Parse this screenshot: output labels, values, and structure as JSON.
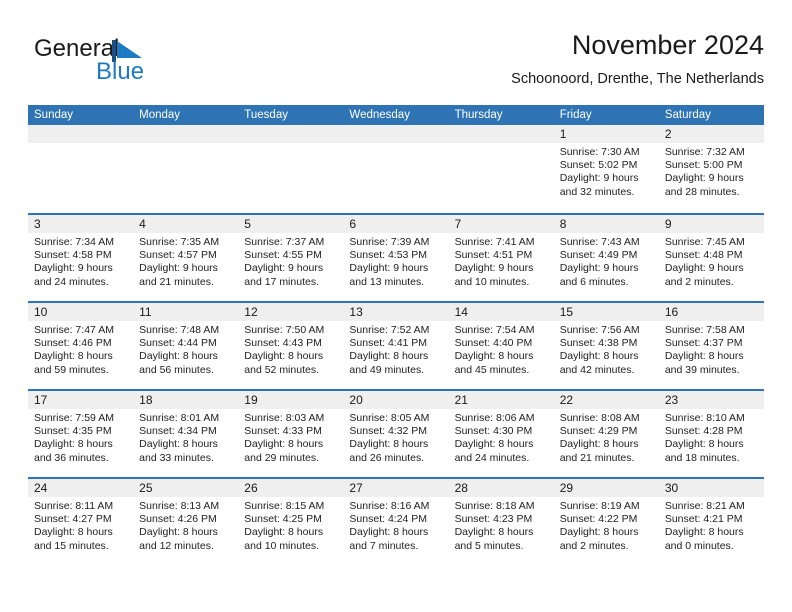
{
  "brand": {
    "word_one": "General",
    "word_two": "Blue",
    "mark": "triangle-flag-icon",
    "accent_color": "#1f7ac4"
  },
  "header": {
    "title": "November 2024",
    "subtitle": "Schoonoord, Drenthe, The Netherlands"
  },
  "colors": {
    "header_blue": "#2e74b5",
    "daynum_band": "#efefef",
    "text": "#1a1a1a"
  },
  "weekdays": [
    "Sunday",
    "Monday",
    "Tuesday",
    "Wednesday",
    "Thursday",
    "Friday",
    "Saturday"
  ],
  "labels": {
    "sunrise": "Sunrise:",
    "sunset": "Sunset:",
    "daylight": "Daylight:"
  },
  "weeks": [
    [
      {
        "day": "",
        "empty": true
      },
      {
        "day": "",
        "empty": true
      },
      {
        "day": "",
        "empty": true
      },
      {
        "day": "",
        "empty": true
      },
      {
        "day": "",
        "empty": true
      },
      {
        "day": "1",
        "sunrise": "Sunrise: 7:30 AM",
        "sunset": "Sunset: 5:02 PM",
        "daylight1": "Daylight: 9 hours",
        "daylight2": "and 32 minutes."
      },
      {
        "day": "2",
        "sunrise": "Sunrise: 7:32 AM",
        "sunset": "Sunset: 5:00 PM",
        "daylight1": "Daylight: 9 hours",
        "daylight2": "and 28 minutes."
      }
    ],
    [
      {
        "day": "3",
        "sunrise": "Sunrise: 7:34 AM",
        "sunset": "Sunset: 4:58 PM",
        "daylight1": "Daylight: 9 hours",
        "daylight2": "and 24 minutes."
      },
      {
        "day": "4",
        "sunrise": "Sunrise: 7:35 AM",
        "sunset": "Sunset: 4:57 PM",
        "daylight1": "Daylight: 9 hours",
        "daylight2": "and 21 minutes."
      },
      {
        "day": "5",
        "sunrise": "Sunrise: 7:37 AM",
        "sunset": "Sunset: 4:55 PM",
        "daylight1": "Daylight: 9 hours",
        "daylight2": "and 17 minutes."
      },
      {
        "day": "6",
        "sunrise": "Sunrise: 7:39 AM",
        "sunset": "Sunset: 4:53 PM",
        "daylight1": "Daylight: 9 hours",
        "daylight2": "and 13 minutes."
      },
      {
        "day": "7",
        "sunrise": "Sunrise: 7:41 AM",
        "sunset": "Sunset: 4:51 PM",
        "daylight1": "Daylight: 9 hours",
        "daylight2": "and 10 minutes."
      },
      {
        "day": "8",
        "sunrise": "Sunrise: 7:43 AM",
        "sunset": "Sunset: 4:49 PM",
        "daylight1": "Daylight: 9 hours",
        "daylight2": "and 6 minutes."
      },
      {
        "day": "9",
        "sunrise": "Sunrise: 7:45 AM",
        "sunset": "Sunset: 4:48 PM",
        "daylight1": "Daylight: 9 hours",
        "daylight2": "and 2 minutes."
      }
    ],
    [
      {
        "day": "10",
        "sunrise": "Sunrise: 7:47 AM",
        "sunset": "Sunset: 4:46 PM",
        "daylight1": "Daylight: 8 hours",
        "daylight2": "and 59 minutes."
      },
      {
        "day": "11",
        "sunrise": "Sunrise: 7:48 AM",
        "sunset": "Sunset: 4:44 PM",
        "daylight1": "Daylight: 8 hours",
        "daylight2": "and 56 minutes."
      },
      {
        "day": "12",
        "sunrise": "Sunrise: 7:50 AM",
        "sunset": "Sunset: 4:43 PM",
        "daylight1": "Daylight: 8 hours",
        "daylight2": "and 52 minutes."
      },
      {
        "day": "13",
        "sunrise": "Sunrise: 7:52 AM",
        "sunset": "Sunset: 4:41 PM",
        "daylight1": "Daylight: 8 hours",
        "daylight2": "and 49 minutes."
      },
      {
        "day": "14",
        "sunrise": "Sunrise: 7:54 AM",
        "sunset": "Sunset: 4:40 PM",
        "daylight1": "Daylight: 8 hours",
        "daylight2": "and 45 minutes."
      },
      {
        "day": "15",
        "sunrise": "Sunrise: 7:56 AM",
        "sunset": "Sunset: 4:38 PM",
        "daylight1": "Daylight: 8 hours",
        "daylight2": "and 42 minutes."
      },
      {
        "day": "16",
        "sunrise": "Sunrise: 7:58 AM",
        "sunset": "Sunset: 4:37 PM",
        "daylight1": "Daylight: 8 hours",
        "daylight2": "and 39 minutes."
      }
    ],
    [
      {
        "day": "17",
        "sunrise": "Sunrise: 7:59 AM",
        "sunset": "Sunset: 4:35 PM",
        "daylight1": "Daylight: 8 hours",
        "daylight2": "and 36 minutes."
      },
      {
        "day": "18",
        "sunrise": "Sunrise: 8:01 AM",
        "sunset": "Sunset: 4:34 PM",
        "daylight1": "Daylight: 8 hours",
        "daylight2": "and 33 minutes."
      },
      {
        "day": "19",
        "sunrise": "Sunrise: 8:03 AM",
        "sunset": "Sunset: 4:33 PM",
        "daylight1": "Daylight: 8 hours",
        "daylight2": "and 29 minutes."
      },
      {
        "day": "20",
        "sunrise": "Sunrise: 8:05 AM",
        "sunset": "Sunset: 4:32 PM",
        "daylight1": "Daylight: 8 hours",
        "daylight2": "and 26 minutes."
      },
      {
        "day": "21",
        "sunrise": "Sunrise: 8:06 AM",
        "sunset": "Sunset: 4:30 PM",
        "daylight1": "Daylight: 8 hours",
        "daylight2": "and 24 minutes."
      },
      {
        "day": "22",
        "sunrise": "Sunrise: 8:08 AM",
        "sunset": "Sunset: 4:29 PM",
        "daylight1": "Daylight: 8 hours",
        "daylight2": "and 21 minutes."
      },
      {
        "day": "23",
        "sunrise": "Sunrise: 8:10 AM",
        "sunset": "Sunset: 4:28 PM",
        "daylight1": "Daylight: 8 hours",
        "daylight2": "and 18 minutes."
      }
    ],
    [
      {
        "day": "24",
        "sunrise": "Sunrise: 8:11 AM",
        "sunset": "Sunset: 4:27 PM",
        "daylight1": "Daylight: 8 hours",
        "daylight2": "and 15 minutes."
      },
      {
        "day": "25",
        "sunrise": "Sunrise: 8:13 AM",
        "sunset": "Sunset: 4:26 PM",
        "daylight1": "Daylight: 8 hours",
        "daylight2": "and 12 minutes."
      },
      {
        "day": "26",
        "sunrise": "Sunrise: 8:15 AM",
        "sunset": "Sunset: 4:25 PM",
        "daylight1": "Daylight: 8 hours",
        "daylight2": "and 10 minutes."
      },
      {
        "day": "27",
        "sunrise": "Sunrise: 8:16 AM",
        "sunset": "Sunset: 4:24 PM",
        "daylight1": "Daylight: 8 hours",
        "daylight2": "and 7 minutes."
      },
      {
        "day": "28",
        "sunrise": "Sunrise: 8:18 AM",
        "sunset": "Sunset: 4:23 PM",
        "daylight1": "Daylight: 8 hours",
        "daylight2": "and 5 minutes."
      },
      {
        "day": "29",
        "sunrise": "Sunrise: 8:19 AM",
        "sunset": "Sunset: 4:22 PM",
        "daylight1": "Daylight: 8 hours",
        "daylight2": "and 2 minutes."
      },
      {
        "day": "30",
        "sunrise": "Sunrise: 8:21 AM",
        "sunset": "Sunset: 4:21 PM",
        "daylight1": "Daylight: 8 hours",
        "daylight2": "and 0 minutes."
      }
    ]
  ]
}
